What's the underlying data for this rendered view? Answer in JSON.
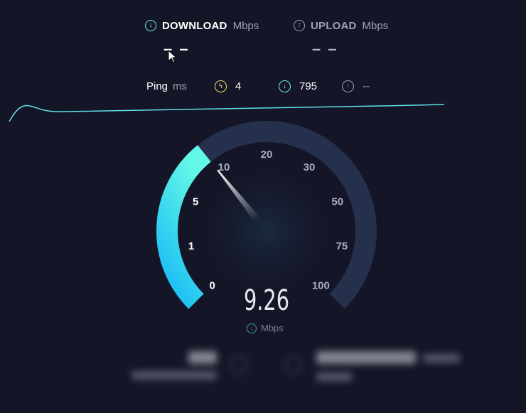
{
  "header": {
    "download_label": "DOWNLOAD",
    "upload_label": "UPLOAD",
    "unit": "Mbps",
    "download_value": "– –",
    "upload_value": "– –"
  },
  "ping": {
    "label": "Ping",
    "unit": "ms",
    "idle": "4",
    "download": "795",
    "upload": "--"
  },
  "gauge": {
    "ticks": [
      "0",
      "1",
      "5",
      "10",
      "20",
      "30",
      "50",
      "75",
      "100"
    ],
    "value": "9.26",
    "unit": "Mbps",
    "needle_value": 9.26
  },
  "colors": {
    "background": "#141526",
    "accent_cyan": "#6af3e4",
    "gauge_track": "#25304d",
    "ping_yellow": "#f2e27a",
    "gauge_fill_start": "#15b8f5",
    "gauge_fill_end": "#62f7e8"
  },
  "icons": {
    "download": "arrow-down-circle-icon",
    "upload": "arrow-up-circle-icon",
    "idle": "lightning-circle-icon"
  }
}
